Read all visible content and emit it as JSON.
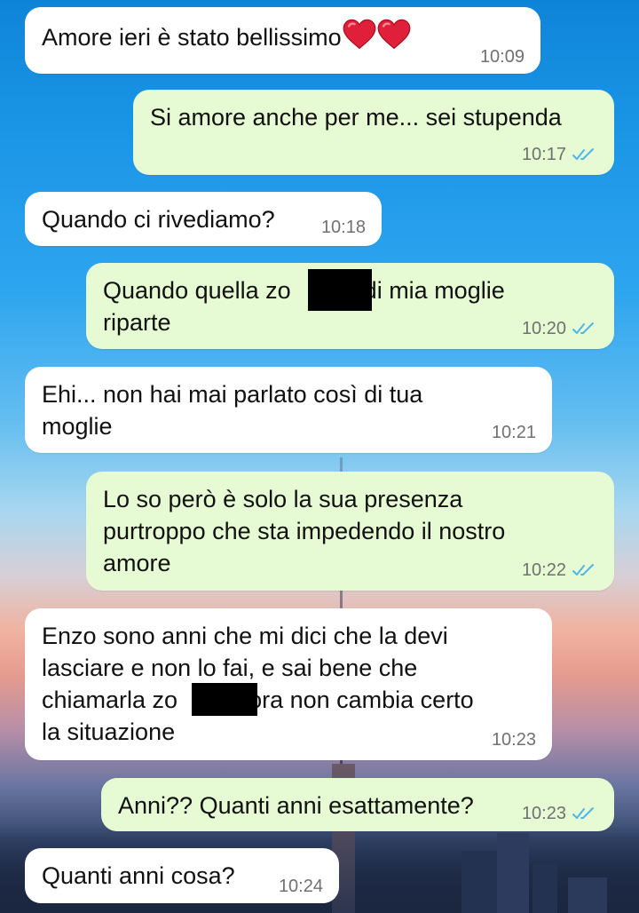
{
  "chat": {
    "messages": [
      {
        "direction": "incoming",
        "text": "Amore ieri è stato bellissimo",
        "time": "10:09"
      },
      {
        "direction": "outgoing",
        "text": "Si amore anche per me... sei stupenda",
        "time": "10:17",
        "ticks": "read"
      },
      {
        "direction": "incoming",
        "text": "Quando ci rivediamo?",
        "time": "10:18"
      },
      {
        "direction": "outgoing",
        "text_part1": "Quando quella zo",
        "text_part2": "di mia moglie",
        "text_line2": "riparte",
        "time": "10:20",
        "ticks": "read"
      },
      {
        "direction": "incoming",
        "text": "Ehi... non hai mai parlato così di tua\nmoglie",
        "time": "10:21"
      },
      {
        "direction": "outgoing",
        "text": "Lo so però è solo la sua presenza\npurtroppo che sta impedendo il nostro\namore",
        "time": "10:22",
        "ticks": "read"
      },
      {
        "direction": "incoming",
        "text_line1": "Enzo sono anni che mi dici che la devi",
        "text_line2": "lasciare e non lo fai, e sai bene che",
        "text_part1": "chiamarla zo",
        "text_part2": "ora non cambia certo",
        "text_line4": "la situazione",
        "time": "10:23"
      },
      {
        "direction": "outgoing",
        "text": "Anni?? Quanti anni esattamente?",
        "time": "10:23",
        "ticks": "read"
      },
      {
        "direction": "incoming",
        "text": "Quanti anni cosa?",
        "time": "10:24"
      }
    ]
  },
  "colors": {
    "incoming_bubble": "#ffffff",
    "outgoing_bubble": "#e6fbd4",
    "read_ticks": "#4fb6ec",
    "timestamp": "#707070",
    "heart": "#e0203a"
  },
  "icons": {
    "read_receipt": "double-check-icon",
    "emoji": "red-heart-icon"
  }
}
